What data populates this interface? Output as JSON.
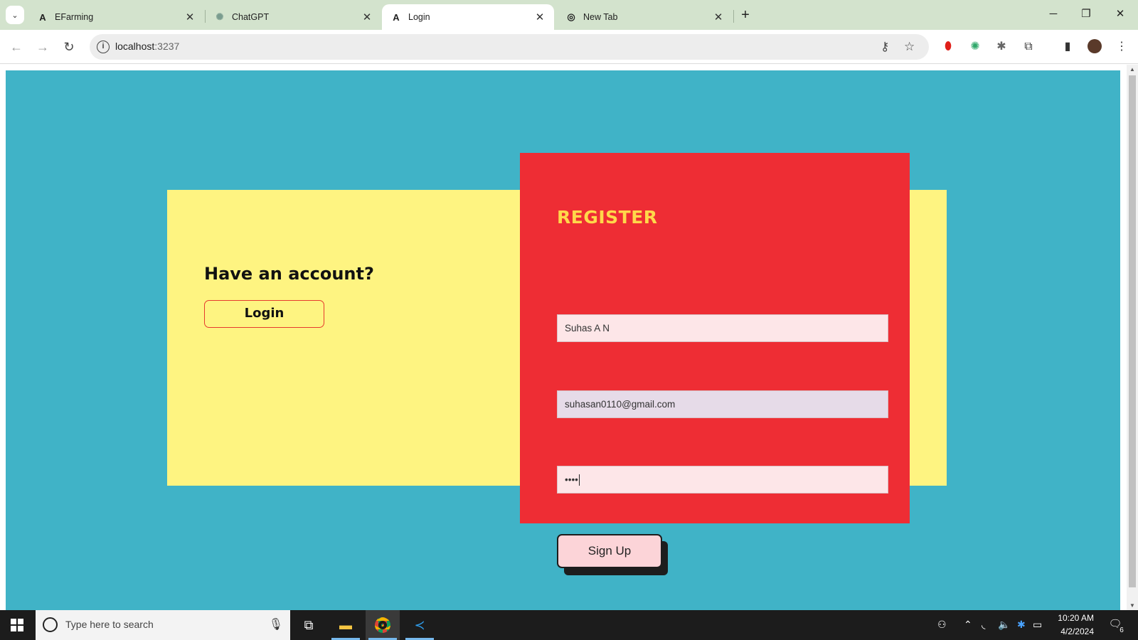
{
  "browser": {
    "tabs": [
      {
        "title": "EFarming",
        "favicon": "angular-icon",
        "active": false
      },
      {
        "title": "ChatGPT",
        "favicon": "chatgpt-icon",
        "active": false
      },
      {
        "title": "Login",
        "favicon": "angular-icon",
        "active": true
      },
      {
        "title": "New Tab",
        "favicon": "chrome-icon",
        "active": false
      }
    ],
    "url_host": "localhost",
    "url_port": ":3237"
  },
  "page": {
    "have_account": "Have an account?",
    "login_label": "Login",
    "register_title": "REGISTER",
    "name_value": "Suhas A N",
    "email_value": "suhasan0110@gmail.com",
    "password_mask": "••••",
    "signup_label": "Sign Up"
  },
  "taskbar": {
    "search_placeholder": "Type here to search",
    "time": "10:20 AM",
    "date": "4/2/2024",
    "notification_count": "6"
  },
  "colors": {
    "page_bg": "#40b3c7",
    "yellow_card": "#fef481",
    "red_card": "#ee2d34",
    "title_yellow": "#ffd84a"
  }
}
